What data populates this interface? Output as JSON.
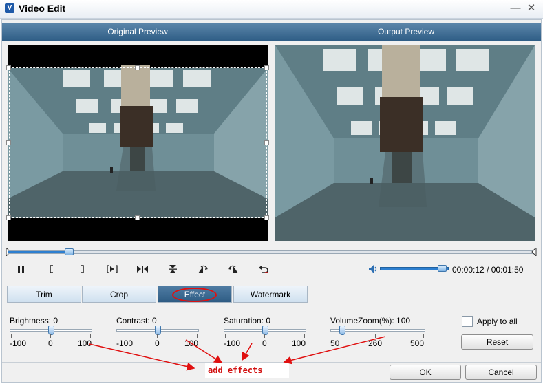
{
  "window": {
    "title": "Video Edit",
    "app_icon": "V"
  },
  "header": {
    "original_label": "Original Preview",
    "output_label": "Output Preview"
  },
  "playback": {
    "progress_fraction": 0.115,
    "volume_fraction": 0.9,
    "current_time": "00:00:12",
    "separator": "/",
    "total_time": "00:01:50"
  },
  "tabs": [
    {
      "label": "Trim",
      "active": false
    },
    {
      "label": "Crop",
      "active": false
    },
    {
      "label": "Effect",
      "active": true
    },
    {
      "label": "Watermark",
      "active": false
    }
  ],
  "effects": {
    "brightness": {
      "label": "Brightness:",
      "value": "0",
      "min": "-100",
      "mid": "0",
      "max": "100",
      "fraction": 0.5
    },
    "contrast": {
      "label": "Contrast:",
      "value": "0",
      "min": "-100",
      "mid": "0",
      "max": "100",
      "fraction": 0.5
    },
    "saturation": {
      "label": "Saturation:",
      "value": "0",
      "min": "-100",
      "mid": "0",
      "max": "100",
      "fraction": 0.5
    },
    "volumezoom": {
      "label": "VolumeZoom(%):",
      "value": "100",
      "min": "50",
      "mid": "260",
      "max": "500",
      "fraction": 0.11
    }
  },
  "apply_to_all": {
    "label": "Apply to all",
    "checked": false
  },
  "buttons": {
    "reset": "Reset",
    "ok": "OK",
    "cancel": "Cancel"
  },
  "annotation": {
    "text": "add effects",
    "color": "#d21010"
  },
  "colors": {
    "header": "#3a6891",
    "accent": "#2d7fd0",
    "annotation": "#e01010"
  }
}
